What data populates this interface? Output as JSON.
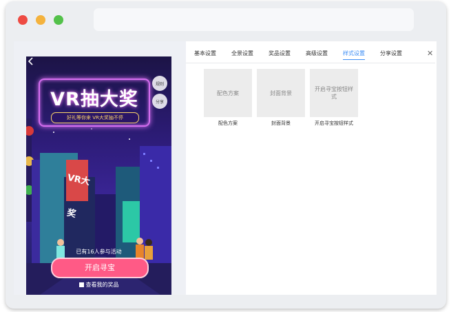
{
  "browser": {
    "traffic_lights": [
      "#ee4b43",
      "#f4b23d",
      "#53c14a"
    ]
  },
  "preview": {
    "title": "VR抽大奖",
    "subtitle": "好礼等你来 VR大奖抽不停",
    "side_buttons": [
      "规则",
      "分享"
    ],
    "sign_text": "VR大奖",
    "participants": "已有16人参与活动",
    "cta": "开启寻宝",
    "prize_link": "查看我的奖品"
  },
  "settings": {
    "tabs": [
      "基本设置",
      "全景设置",
      "奖品设置",
      "高级设置",
      "样式设置",
      "分享设置"
    ],
    "active_tab": 4,
    "cards": [
      {
        "placeholder": "配色方案",
        "caption": "配色方案"
      },
      {
        "placeholder": "封面背景",
        "caption": "封面背景"
      },
      {
        "placeholder": "开启寻宝按钮样式",
        "caption": "开启寻宝按钮样式"
      }
    ]
  },
  "colors": {
    "accent": "#3c8df5",
    "cta": "#ff5a86",
    "neon": "#d56ef0"
  }
}
